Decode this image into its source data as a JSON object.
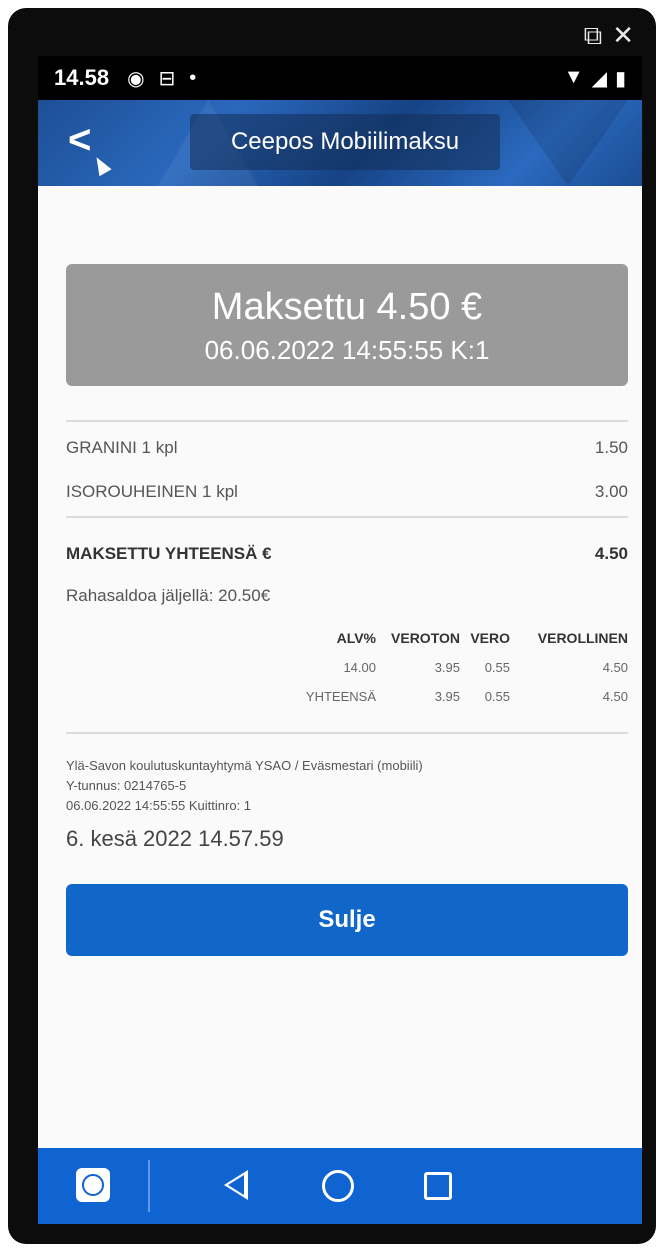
{
  "window_controls": {
    "popout_glyph": "⧉",
    "close_glyph": "✕"
  },
  "status_bar": {
    "time": "14.58",
    "icons": [
      "eye-icon",
      "teamviewer-icon",
      "dot-icon",
      "wifi-icon",
      "signal-icon",
      "battery-icon"
    ]
  },
  "app_bar": {
    "title": "Ceepos Mobiilimaksu",
    "back_glyph": "<"
  },
  "payment": {
    "amount": "Maksettu 4.50 €",
    "datetime": "06.06.2022 14:55:55 K:1"
  },
  "items": [
    {
      "name": "GRANINI 1 kpl",
      "price": "1.50"
    },
    {
      "name": "ISOROUHEINEN 1 kpl",
      "price": "3.00"
    }
  ],
  "total": {
    "label": "MAKSETTU YHTEENSÄ €",
    "value": "4.50"
  },
  "balance": "Rahasaldoa jäljellä: 20.50€",
  "vat_table": {
    "headers": [
      "ALV%",
      "VEROTON",
      "VERO",
      "VEROLLINEN"
    ],
    "rows": [
      [
        "14.00",
        "3.95",
        "0.55",
        "4.50"
      ],
      [
        "YHTEENSÄ",
        "3.95",
        "0.55",
        "4.50"
      ]
    ]
  },
  "footer": {
    "merchant": "Ylä-Savon koulutuskuntayhtymä YSAO / Eväsmestari (mobiili)",
    "business_id": "Y-tunnus: 0214765-5",
    "receipt": "06.06.2022 14:55:55 Kuittinro: 1",
    "timestamp": "6. kesä 2022 14.57.59"
  },
  "close_button": "Sulje",
  "colors": {
    "accent": "#1166c9",
    "appbar": "#1d4f95",
    "paid_box": "#9a9a9a",
    "navbar": "#0f64d2"
  }
}
